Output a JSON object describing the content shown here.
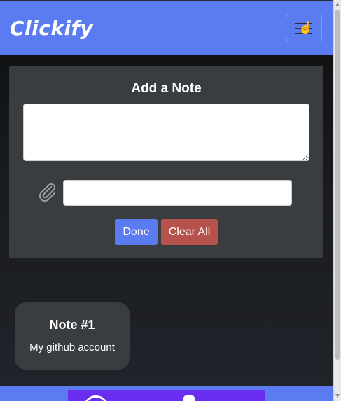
{
  "header": {
    "brand": "Clickify",
    "menu_icon": "hamburger-menu-icon",
    "cursor_icon": "hand-pointer-icon"
  },
  "form": {
    "title": "Add a Note",
    "note_text_value": "",
    "link_value": "",
    "attachment_icon": "paperclip-icon",
    "done_label": "Done",
    "clear_label": "Clear All"
  },
  "notes": [
    {
      "title": "Note #1",
      "body": "My github account"
    }
  ],
  "colors": {
    "accent": "#5b7cf0",
    "danger": "#b5524c",
    "card": "#3a3d40",
    "footer_block": "#6a2ef0"
  }
}
